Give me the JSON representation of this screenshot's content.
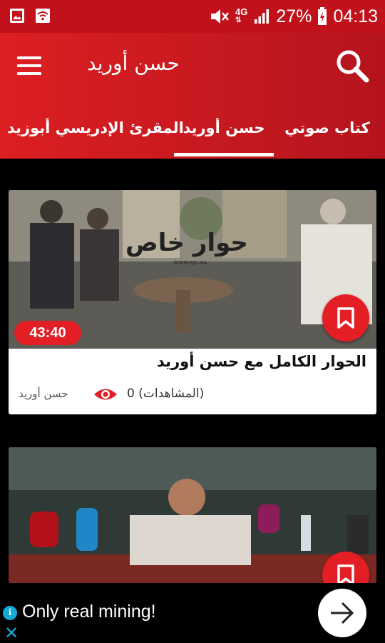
{
  "status_bar": {
    "battery": "27%",
    "time": "04:13",
    "network": "4G",
    "icons": [
      "gallery-icon",
      "wifi-icon",
      "mute-icon",
      "network-4g-icon",
      "signal-icon",
      "battery-charging-icon"
    ]
  },
  "app_bar": {
    "title": "حسن أوريد",
    "menu_icon": "hamburger-menu-icon",
    "search_icon": "search-icon"
  },
  "tabs": [
    {
      "label": "كتاب صوتي",
      "selected": false
    },
    {
      "label": "حسن أوريد",
      "selected": true
    },
    {
      "label": "المقرئ الإدريسي أبوزيد",
      "selected": false
    }
  ],
  "videos": [
    {
      "duration": "43:40",
      "title": "الحوار الكامل مع حسن أوريد",
      "views": "0 (المشاهدات)",
      "author": "حسن أوريد",
      "thumbnail_overlay_text": "حوار خاص",
      "thumbnail_watermark": "WWW.FJD.MA"
    },
    {
      "duration": "",
      "title": "",
      "views": "",
      "author": ""
    }
  ],
  "ad": {
    "text": "Only real mining!",
    "info_label": "i",
    "close_label": "✕",
    "arrow_icon": "arrow-right-icon"
  },
  "colors": {
    "brand_red": "#d81b22",
    "background": "#000000",
    "card": "#ffffff",
    "ad_accent": "#14a9d6"
  }
}
